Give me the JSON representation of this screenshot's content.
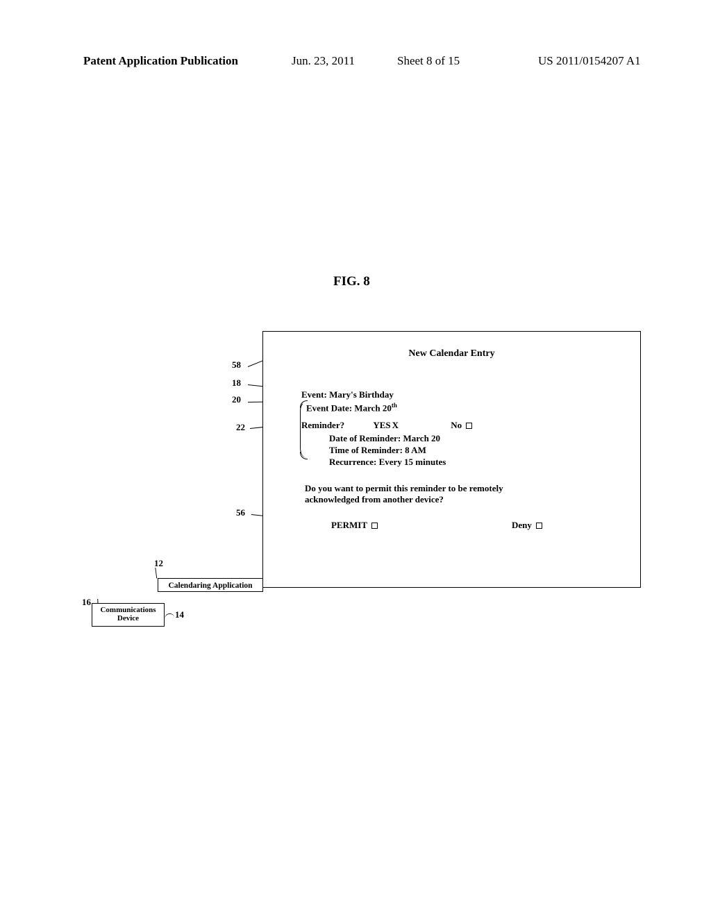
{
  "header": {
    "left": "Patent Application Publication",
    "date": "Jun. 23, 2011",
    "sheet": "Sheet 8 of 15",
    "pubnum": "US 2011/0154207 A1"
  },
  "figure_label": "FIG. 8",
  "refs": {
    "r58": "58",
    "r18": "18",
    "r20": "20",
    "r22": "22",
    "r56": "56",
    "r12": "12",
    "r16": "16",
    "r14": "14"
  },
  "window": {
    "title": "New Calendar Entry",
    "event_label": "Event:",
    "event_value": "Mary's Birthday",
    "date_label": "Event Date:",
    "date_value": "March 20",
    "date_suffix": "th",
    "reminder_label": "Reminder?",
    "yes": "YES",
    "yes_mark": "X",
    "no": "No",
    "sub_date": "Date of Reminder: March 20",
    "sub_time": "Time of Reminder: 8 AM",
    "sub_recur": "Recurrence: Every 15 minutes",
    "question": "Do you want to permit this reminder to be remotely acknowledged from another device?",
    "permit": "PERMIT",
    "deny": "Deny"
  },
  "boxes": {
    "calapp": "Calendaring Application",
    "comm": "Communications Device"
  }
}
